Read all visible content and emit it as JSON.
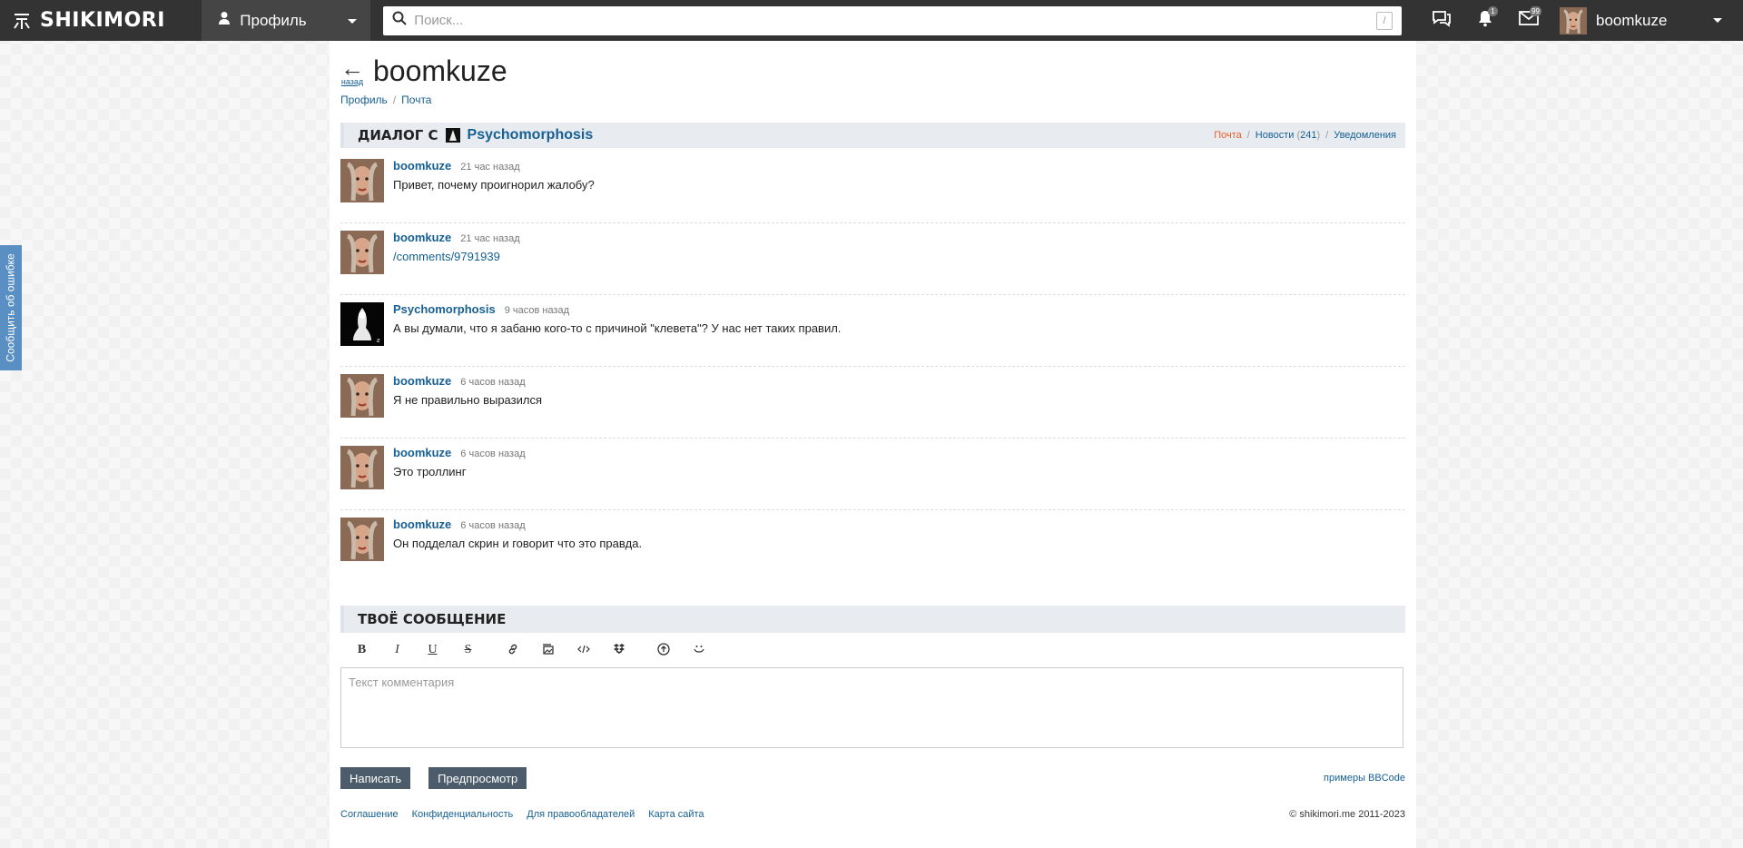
{
  "topbar": {
    "logo_text": "SHIKIMORI",
    "menu_label": "Профиль",
    "search_placeholder": "Поиск...",
    "search_shortcut": "/",
    "notif_badge": "1",
    "mail_badge": "99",
    "username": "boomkuze"
  },
  "report_tab": "Сообщить об ошибке",
  "page": {
    "back_label": "назад",
    "title": "boomkuze",
    "breadcrumb": [
      "Профиль",
      "Почта"
    ]
  },
  "dialog": {
    "title": "ДИАЛОГ С",
    "user": "Psychomorphosis",
    "links": {
      "mail": "Почта",
      "news": "Новости",
      "news_count": "241",
      "notifications": "Уведомления"
    }
  },
  "messages": [
    {
      "author": "boomkuze",
      "time": "21 час назад",
      "text": "Привет, почему проигнорил жалобу?",
      "kind": "me"
    },
    {
      "author": "boomkuze",
      "time": "21 час назад",
      "text": "/comments/9791939",
      "kind": "me",
      "is_link": true
    },
    {
      "author": "Psychomorphosis",
      "time": "9 часов назад",
      "text": "А вы думали, что я забаню кого-то с причиной \"клевета\"? У нас нет таких правил.",
      "kind": "other"
    },
    {
      "author": "boomkuze",
      "time": "6 часов назад",
      "text": "Я не правильно выразился",
      "kind": "me"
    },
    {
      "author": "boomkuze",
      "time": "6 часов назад",
      "text": "Это троллинг",
      "kind": "me"
    },
    {
      "author": "boomkuze",
      "time": "6 часов назад",
      "text": "Он подделал скрин и говорит что это правда.",
      "kind": "me"
    }
  ],
  "compose": {
    "title": "ТВОЁ СООБЩЕНИЕ",
    "toolbar": [
      "B",
      "I",
      "U",
      "S"
    ],
    "placeholder": "Текст комментария",
    "submit_label": "Написать",
    "preview_label": "Предпросмотр",
    "bbcode_label": "примеры BBCode"
  },
  "footer": {
    "links": [
      "Соглашение",
      "Конфиденциальность",
      "Для правообладателей",
      "Карта сайта"
    ],
    "copyright": "© shikimori.me 2011-2023"
  }
}
